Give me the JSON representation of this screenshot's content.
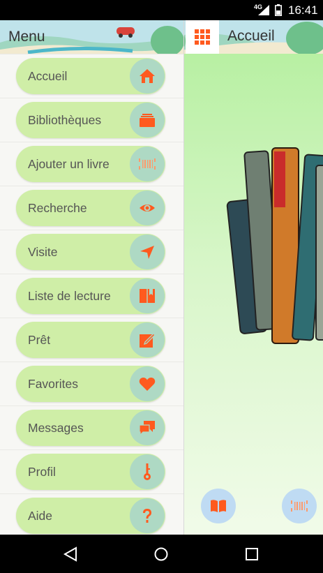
{
  "status_bar": {
    "network": "4G",
    "time": "16:41"
  },
  "drawer": {
    "title": "Menu",
    "items": [
      {
        "label": "Accueil",
        "icon": "home-icon"
      },
      {
        "label": "Bibliothèques",
        "icon": "library-icon"
      },
      {
        "label": "Ajouter un livre",
        "icon": "barcode-icon"
      },
      {
        "label": "Recherche",
        "icon": "eye-icon"
      },
      {
        "label": "Visite",
        "icon": "navigation-arrow-icon"
      },
      {
        "label": "Liste de lecture",
        "icon": "open-book-icon"
      },
      {
        "label": "Prêt",
        "icon": "edit-icon"
      },
      {
        "label": "Favorites",
        "icon": "heart-icon"
      },
      {
        "label": "Messages",
        "icon": "chat-icon"
      },
      {
        "label": "Profil",
        "icon": "key-icon"
      },
      {
        "label": "Aide",
        "icon": "question-icon"
      }
    ]
  },
  "header": {
    "title": "Accueil",
    "grid_icon": "grid-menu-icon"
  },
  "fabs": [
    {
      "icon": "open-book-icon"
    },
    {
      "icon": "barcode-icon"
    }
  ],
  "colors": {
    "accent": "#ff5a1f",
    "pill": "#cfeea7",
    "icon_circle": "#aed9c4",
    "fab": "#bfdbf3"
  },
  "navbar": {
    "icons": [
      "back-icon",
      "home-circle-icon",
      "recents-icon"
    ]
  }
}
